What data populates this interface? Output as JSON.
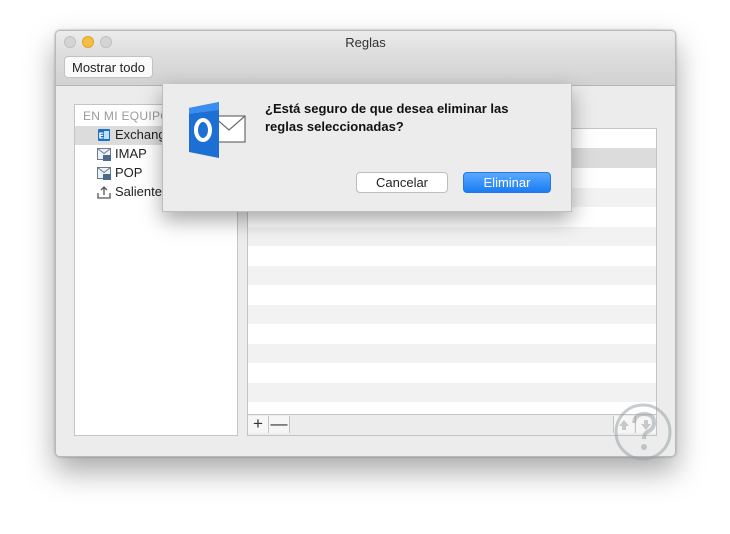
{
  "window": {
    "title": "Reglas"
  },
  "toolbar": {
    "show_all_label": "Mostrar todo"
  },
  "sidebar": {
    "header": "EN MI EQUIPO",
    "items": [
      {
        "label": "Exchange",
        "icon": "exchange-icon",
        "selected": true
      },
      {
        "label": "IMAP",
        "icon": "imap-icon",
        "selected": false
      },
      {
        "label": "POP",
        "icon": "pop-icon",
        "selected": false
      },
      {
        "label": "Saliente",
        "icon": "outgoing-icon",
        "selected": false
      }
    ]
  },
  "rules_list": {
    "add_label": "+",
    "remove_label": "—"
  },
  "dialog": {
    "icon": "outlook-icon",
    "message": "¿Está seguro de que desea eliminar las reglas seleccionadas?",
    "cancel_label": "Cancelar",
    "delete_label": "Eliminar",
    "accent_color": "#1a7cf3"
  },
  "watermark": {
    "icon": "question-head-icon"
  }
}
